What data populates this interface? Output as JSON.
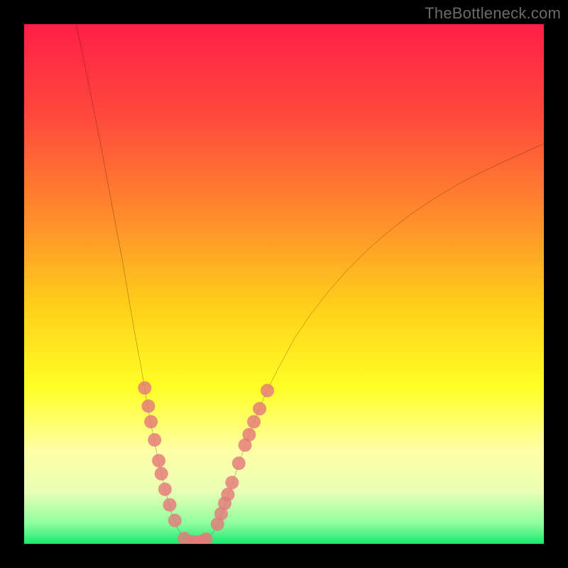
{
  "watermark": "TheBottleneck.com",
  "chart_data": {
    "type": "line",
    "title": "",
    "xlabel": "",
    "ylabel": "",
    "xlim": [
      0,
      100
    ],
    "ylim": [
      0,
      100
    ],
    "grid": false,
    "legend": false,
    "gradient_stops": [
      {
        "offset": 0,
        "color": "#ff1f47"
      },
      {
        "offset": 18,
        "color": "#ff4a3c"
      },
      {
        "offset": 38,
        "color": "#ff8f2a"
      },
      {
        "offset": 55,
        "color": "#ffd21a"
      },
      {
        "offset": 70,
        "color": "#ffff26"
      },
      {
        "offset": 82,
        "color": "#ffffa6"
      },
      {
        "offset": 90,
        "color": "#e9ffb4"
      },
      {
        "offset": 96,
        "color": "#8fffa0"
      },
      {
        "offset": 100,
        "color": "#19e86e"
      }
    ],
    "series": [
      {
        "name": "bottleneck-curve",
        "stroke": "#000000",
        "points": [
          {
            "x": 10.0,
            "y": 100.0
          },
          {
            "x": 11.5,
            "y": 93.0
          },
          {
            "x": 13.0,
            "y": 85.5
          },
          {
            "x": 14.5,
            "y": 78.0
          },
          {
            "x": 16.0,
            "y": 70.0
          },
          {
            "x": 17.5,
            "y": 62.0
          },
          {
            "x": 19.0,
            "y": 54.0
          },
          {
            "x": 20.0,
            "y": 48.0
          },
          {
            "x": 21.2,
            "y": 41.0
          },
          {
            "x": 22.5,
            "y": 34.0
          },
          {
            "x": 23.5,
            "y": 28.0
          },
          {
            "x": 24.5,
            "y": 22.5
          },
          {
            "x": 25.5,
            "y": 17.5
          },
          {
            "x": 26.5,
            "y": 13.0
          },
          {
            "x": 27.5,
            "y": 9.0
          },
          {
            "x": 28.5,
            "y": 5.5
          },
          {
            "x": 29.5,
            "y": 3.0
          },
          {
            "x": 30.5,
            "y": 1.4
          },
          {
            "x": 31.5,
            "y": 0.6
          },
          {
            "x": 33.0,
            "y": 0.2
          },
          {
            "x": 34.5,
            "y": 0.5
          },
          {
            "x": 35.5,
            "y": 1.2
          },
          {
            "x": 36.5,
            "y": 2.5
          },
          {
            "x": 37.5,
            "y": 4.5
          },
          {
            "x": 38.5,
            "y": 7.0
          },
          {
            "x": 39.5,
            "y": 10.0
          },
          {
            "x": 40.5,
            "y": 13.0
          },
          {
            "x": 42.0,
            "y": 17.5
          },
          {
            "x": 44.0,
            "y": 23.0
          },
          {
            "x": 46.5,
            "y": 29.0
          },
          {
            "x": 49.0,
            "y": 34.0
          },
          {
            "x": 52.0,
            "y": 39.5
          },
          {
            "x": 55.0,
            "y": 44.0
          },
          {
            "x": 58.5,
            "y": 48.5
          },
          {
            "x": 62.0,
            "y": 52.5
          },
          {
            "x": 66.0,
            "y": 56.5
          },
          {
            "x": 70.0,
            "y": 60.0
          },
          {
            "x": 74.5,
            "y": 63.5
          },
          {
            "x": 79.0,
            "y": 66.5
          },
          {
            "x": 84.0,
            "y": 69.5
          },
          {
            "x": 89.0,
            "y": 72.0
          },
          {
            "x": 94.0,
            "y": 74.3
          },
          {
            "x": 100.0,
            "y": 77.0
          }
        ]
      }
    ],
    "scatter": {
      "name": "highlight-dots",
      "color": "#e47a7a",
      "radius": 1.3,
      "points": [
        {
          "x": 23.2,
          "y": 30.0
        },
        {
          "x": 23.9,
          "y": 26.5
        },
        {
          "x": 24.4,
          "y": 23.5
        },
        {
          "x": 25.1,
          "y": 20.0
        },
        {
          "x": 25.9,
          "y": 16.0
        },
        {
          "x": 26.4,
          "y": 13.5
        },
        {
          "x": 27.1,
          "y": 10.5
        },
        {
          "x": 28.0,
          "y": 7.5
        },
        {
          "x": 29.0,
          "y": 4.5
        },
        {
          "x": 30.8,
          "y": 1.0
        },
        {
          "x": 32.2,
          "y": 0.4
        },
        {
          "x": 33.2,
          "y": 0.3
        },
        {
          "x": 34.2,
          "y": 0.5
        },
        {
          "x": 35.0,
          "y": 0.9
        },
        {
          "x": 37.2,
          "y": 3.8
        },
        {
          "x": 37.9,
          "y": 5.8
        },
        {
          "x": 38.6,
          "y": 7.8
        },
        {
          "x": 39.2,
          "y": 9.5
        },
        {
          "x": 40.0,
          "y": 11.8
        },
        {
          "x": 41.3,
          "y": 15.5
        },
        {
          "x": 42.5,
          "y": 19.0
        },
        {
          "x": 43.3,
          "y": 21.0
        },
        {
          "x": 44.2,
          "y": 23.5
        },
        {
          "x": 45.3,
          "y": 26.0
        },
        {
          "x": 46.8,
          "y": 29.5
        }
      ]
    }
  }
}
